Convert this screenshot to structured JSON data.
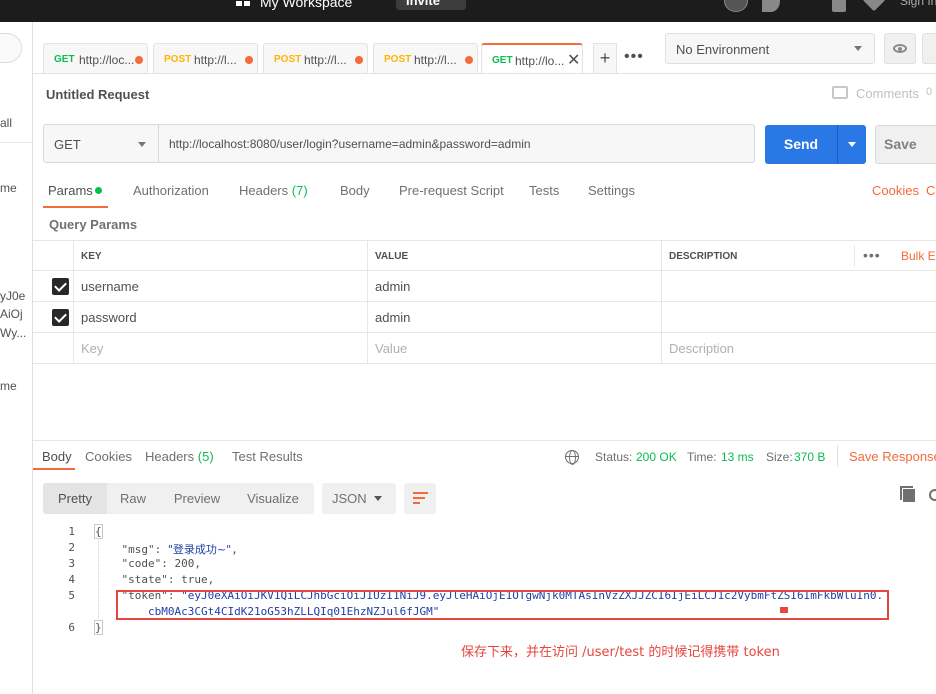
{
  "topbar": {
    "workspace_name": "My Workspace",
    "invite_label": "Invite",
    "signin_label": "Sign In"
  },
  "left_panel": {
    "items": [
      "all",
      "me",
      "yJ0e",
      "AiOj",
      "Wy...",
      "me"
    ]
  },
  "tabs": [
    {
      "method": "GET",
      "url": "http://loc...",
      "unsaved": true
    },
    {
      "method": "POST",
      "url": "http://l...",
      "unsaved": true
    },
    {
      "method": "POST",
      "url": "http://l...",
      "unsaved": true
    },
    {
      "method": "POST",
      "url": "http://l...",
      "unsaved": true
    },
    {
      "method": "GET",
      "url": "http://lo...",
      "active": true
    }
  ],
  "tab_actions": {
    "add": "+",
    "more": "•••",
    "close": "✕"
  },
  "environment": {
    "selected": "No Environment"
  },
  "request": {
    "title": "Untitled Request",
    "comments_label": "Comments",
    "comments_count": "0",
    "method": "GET",
    "url": "http://localhost:8080/user/login?username=admin&password=admin",
    "send_label": "Send",
    "save_label": "Save"
  },
  "request_tabs": {
    "params": "Params",
    "authorization": "Authorization",
    "headers": "Headers",
    "headers_count": "(7)",
    "body": "Body",
    "prerequest": "Pre-request Script",
    "tests": "Tests",
    "settings": "Settings",
    "cookies": "Cookies",
    "code": "Code"
  },
  "query_params": {
    "label": "Query Params",
    "columns": {
      "key": "KEY",
      "value": "VALUE",
      "description": "DESCRIPTION"
    },
    "more": "•••",
    "bulk_edit": "Bulk Edit",
    "rows": [
      {
        "key": "username",
        "value": "admin",
        "checked": true
      },
      {
        "key": "password",
        "value": "admin",
        "checked": true
      }
    ],
    "placeholder": {
      "key": "Key",
      "value": "Value",
      "description": "Description"
    }
  },
  "response": {
    "tabs": {
      "body": "Body",
      "cookies": "Cookies",
      "headers": "Headers",
      "headers_count": "(5)",
      "test_results": "Test Results"
    },
    "status_label": "Status:",
    "status_value": "200 OK",
    "time_label": "Time:",
    "time_value": "13 ms",
    "size_label": "Size:",
    "size_value": "370 B",
    "save_response": "Save Response",
    "view_modes": [
      "Pretty",
      "Raw",
      "Preview",
      "Visualize"
    ],
    "format": "JSON"
  },
  "code": {
    "line_numbers": [
      "1",
      "2",
      "3",
      "4",
      "5",
      "6"
    ],
    "open_brace": "{",
    "close_brace": "}",
    "msg_key": "\"msg\"",
    "msg_value": "\"登录成功~\"",
    "code_key": "\"code\"",
    "code_value": "200",
    "state_key": "\"state\"",
    "state_value": "true",
    "token_key": "\"token\"",
    "token_value_line1": "\"eyJ0eXAiOiJKV1QiLCJhbGciOiJIUzI1NiJ9.eyJleHAiOjE1OTgwNjk0MTAsInVzZXJJZCI6IjEiLCJ1c2VybmFtZSI6ImFkbWluIn0.",
    "token_value_line2": "cbM0Ac3CGt4CIdK21oG53hZLLQIq01EhzNZJul6fJGM\""
  },
  "annotation": "保存下来，并在访问 /user/test 的时候记得携带 token"
}
